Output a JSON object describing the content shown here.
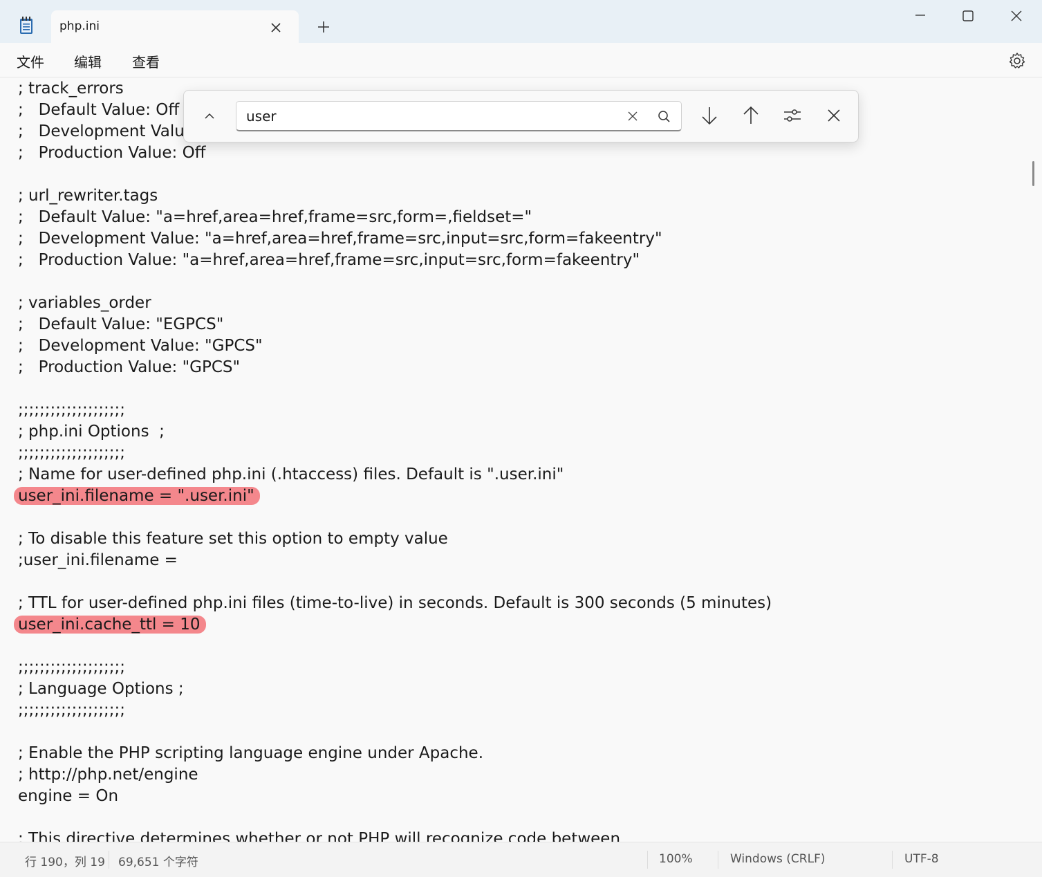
{
  "tab": {
    "title": "php.ini"
  },
  "menu": {
    "file": "文件",
    "edit": "编辑",
    "view": "查看"
  },
  "find": {
    "query": "user"
  },
  "editor": {
    "lines": [
      "; track_errors",
      ";   Default Value: Off",
      ";   Development Value: On",
      ";   Production Value: Off",
      "",
      "; url_rewriter.tags",
      ";   Default Value: \"a=href,area=href,frame=src,form=,fieldset=\"",
      ";   Development Value: \"a=href,area=href,frame=src,input=src,form=fakeentry\"",
      ";   Production Value: \"a=href,area=href,frame=src,input=src,form=fakeentry\"",
      "",
      "; variables_order",
      ";   Default Value: \"EGPCS\"",
      ";   Development Value: \"GPCS\"",
      ";   Production Value: \"GPCS\"",
      "",
      ";;;;;;;;;;;;;;;;;;;;",
      "; php.ini Options  ;",
      ";;;;;;;;;;;;;;;;;;;;",
      "; Name for user-defined php.ini (.htaccess) files. Default is \".user.ini\"",
      "user_ini.filename = \".user.ini\"",
      "",
      "; To disable this feature set this option to empty value",
      ";user_ini.filename =",
      "",
      "; TTL for user-defined php.ini files (time-to-live) in seconds. Default is 300 seconds (5 minutes)",
      "user_ini.cache_ttl = 10",
      "",
      ";;;;;;;;;;;;;;;;;;;;",
      "; Language Options ;",
      ";;;;;;;;;;;;;;;;;;;;",
      "",
      "; Enable the PHP scripting language engine under Apache.",
      "; http://php.net/engine",
      "engine = On",
      "",
      "; This directive determines whether or not PHP will recognize code between"
    ],
    "highlighted_lines": [
      19,
      25
    ]
  },
  "status": {
    "position": "行 190，列 19",
    "chars": "69,651 个字符",
    "zoom": "100%",
    "line_ending": "Windows (CRLF)",
    "encoding": "UTF-8"
  },
  "colors": {
    "highlight": "#f4878c",
    "titlebar": "#e8f0f6",
    "background": "#f9f9f9"
  }
}
